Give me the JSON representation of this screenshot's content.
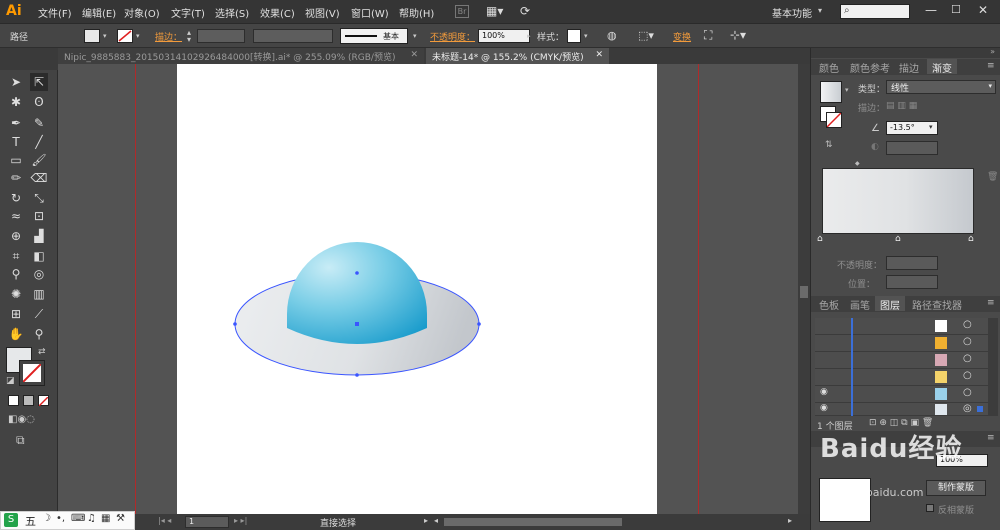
{
  "app": {
    "logo": "Ai",
    "workspace": "基本功能"
  },
  "menu": [
    "文件(F)",
    "编辑(E)",
    "对象(O)",
    "文字(T)",
    "选择(S)",
    "效果(C)",
    "视图(V)",
    "窗口(W)",
    "帮助(H)"
  ],
  "control_bar": {
    "object_type": "路径",
    "stroke_label": "描边：",
    "brush_label": "基本",
    "opacity_label": "不透明度：",
    "opacity_value": "100%",
    "style_label": "样式：",
    "transform_label": "变换"
  },
  "tabs": [
    {
      "label": "Nipic_9885883_20150314102926484000[转换].ai* @ 255.09% (RGB/预览)",
      "active": false
    },
    {
      "label": "未标题-14* @ 155.2% (CMYK/预览)",
      "active": true
    }
  ],
  "gradient_panel": {
    "tabs": [
      "颜色",
      "颜色参考",
      "描边",
      "渐变"
    ],
    "type_label": "类型：",
    "type_value": "线性",
    "stroke_label": "描边：",
    "angle_value": "-13.5°",
    "opacity_label": "不透明度：",
    "position_label": "位置："
  },
  "layers_panel": {
    "tabs": [
      "色板",
      "画笔",
      "图层",
      "路径查找器"
    ],
    "count_label": "1 个图层"
  },
  "transparency_panel": {
    "opacity_value": "100%",
    "make_mask_button": "制作蒙版",
    "invert_mask_label": "反相蒙版"
  },
  "status": {
    "zoom": "1",
    "tool": "直接选择"
  },
  "ime": {
    "label": "五"
  },
  "watermark": {
    "text": "Baidu经验",
    "sub": "jingyan.baidu.com"
  },
  "colors": {
    "accent": "#f29b3c",
    "guide": "#b02a2a",
    "anchor": "#3a55ff"
  }
}
